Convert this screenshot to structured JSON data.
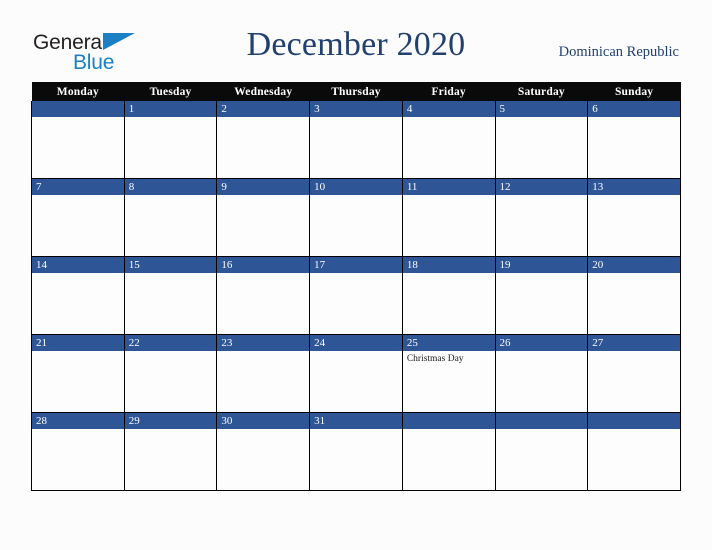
{
  "brand": {
    "name_top": "General",
    "name_bottom": "Blue",
    "triangle_icon": "blue-triangle-icon",
    "top_color": "#231f20",
    "bottom_color": "#1b7fc4"
  },
  "header": {
    "title": "December 2020",
    "region": "Dominican Republic",
    "title_color": "#22406e"
  },
  "calendar": {
    "header_bg": "#0a0a0a",
    "date_band_color": "#2e5596",
    "cell_bg": "#fdfdfe",
    "grid_line_color": "#000000",
    "day_names": [
      "Monday",
      "Tuesday",
      "Wednesday",
      "Thursday",
      "Friday",
      "Saturday",
      "Sunday"
    ],
    "weeks": [
      [
        {
          "date": "",
          "event": ""
        },
        {
          "date": "1",
          "event": ""
        },
        {
          "date": "2",
          "event": ""
        },
        {
          "date": "3",
          "event": ""
        },
        {
          "date": "4",
          "event": ""
        },
        {
          "date": "5",
          "event": ""
        },
        {
          "date": "6",
          "event": ""
        }
      ],
      [
        {
          "date": "7",
          "event": ""
        },
        {
          "date": "8",
          "event": ""
        },
        {
          "date": "9",
          "event": ""
        },
        {
          "date": "10",
          "event": ""
        },
        {
          "date": "11",
          "event": ""
        },
        {
          "date": "12",
          "event": ""
        },
        {
          "date": "13",
          "event": ""
        }
      ],
      [
        {
          "date": "14",
          "event": ""
        },
        {
          "date": "15",
          "event": ""
        },
        {
          "date": "16",
          "event": ""
        },
        {
          "date": "17",
          "event": ""
        },
        {
          "date": "18",
          "event": ""
        },
        {
          "date": "19",
          "event": ""
        },
        {
          "date": "20",
          "event": ""
        }
      ],
      [
        {
          "date": "21",
          "event": ""
        },
        {
          "date": "22",
          "event": ""
        },
        {
          "date": "23",
          "event": ""
        },
        {
          "date": "24",
          "event": ""
        },
        {
          "date": "25",
          "event": "Christmas Day"
        },
        {
          "date": "26",
          "event": ""
        },
        {
          "date": "27",
          "event": ""
        }
      ],
      [
        {
          "date": "28",
          "event": ""
        },
        {
          "date": "29",
          "event": ""
        },
        {
          "date": "30",
          "event": ""
        },
        {
          "date": "31",
          "event": ""
        },
        {
          "date": "",
          "event": ""
        },
        {
          "date": "",
          "event": ""
        },
        {
          "date": "",
          "event": ""
        }
      ]
    ]
  }
}
